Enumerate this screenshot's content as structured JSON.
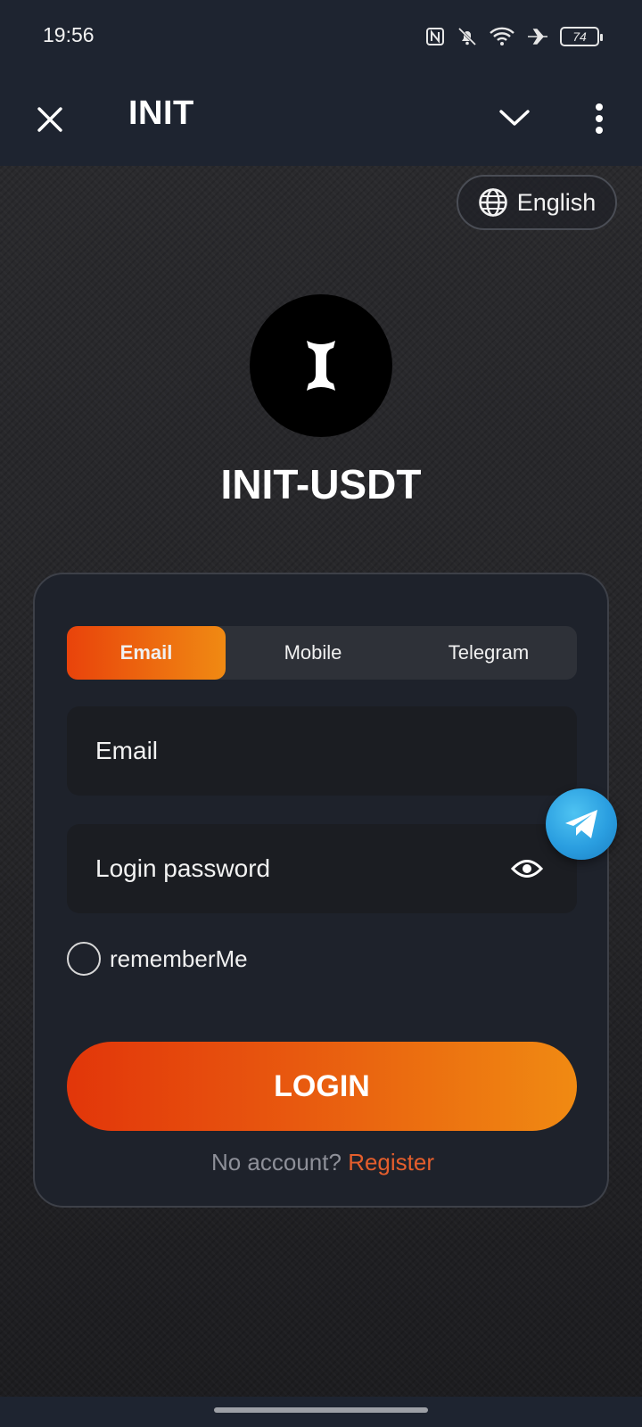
{
  "status_bar": {
    "time": "19:56",
    "battery": "74",
    "icons": [
      "nfc-icon",
      "bell-off-icon",
      "wifi-icon",
      "airplane-icon",
      "battery-icon"
    ]
  },
  "app_bar": {
    "title": "INIT",
    "icons": [
      "close-icon",
      "chevron-down-icon",
      "more-vertical-icon"
    ]
  },
  "language": {
    "label": "English",
    "icon": "globe-icon"
  },
  "brand": {
    "title": "INIT-USDT"
  },
  "login_form": {
    "tabs": [
      {
        "label": "Email",
        "active": true
      },
      {
        "label": "Mobile",
        "active": false
      },
      {
        "label": "Telegram",
        "active": false
      }
    ],
    "email_placeholder": "Email",
    "password_placeholder": "Login password",
    "remember_label": "rememberMe",
    "login_label": "LOGIN",
    "no_account_text": "No account?",
    "register_label": "Register"
  },
  "floating": {
    "icon": "telegram-icon"
  },
  "colors": {
    "accent_start": "#e2360a",
    "accent_end": "#f08a12",
    "register_link": "#e55e2c",
    "card_bg": "#1e222b",
    "bar_bg": "#1e2430"
  }
}
